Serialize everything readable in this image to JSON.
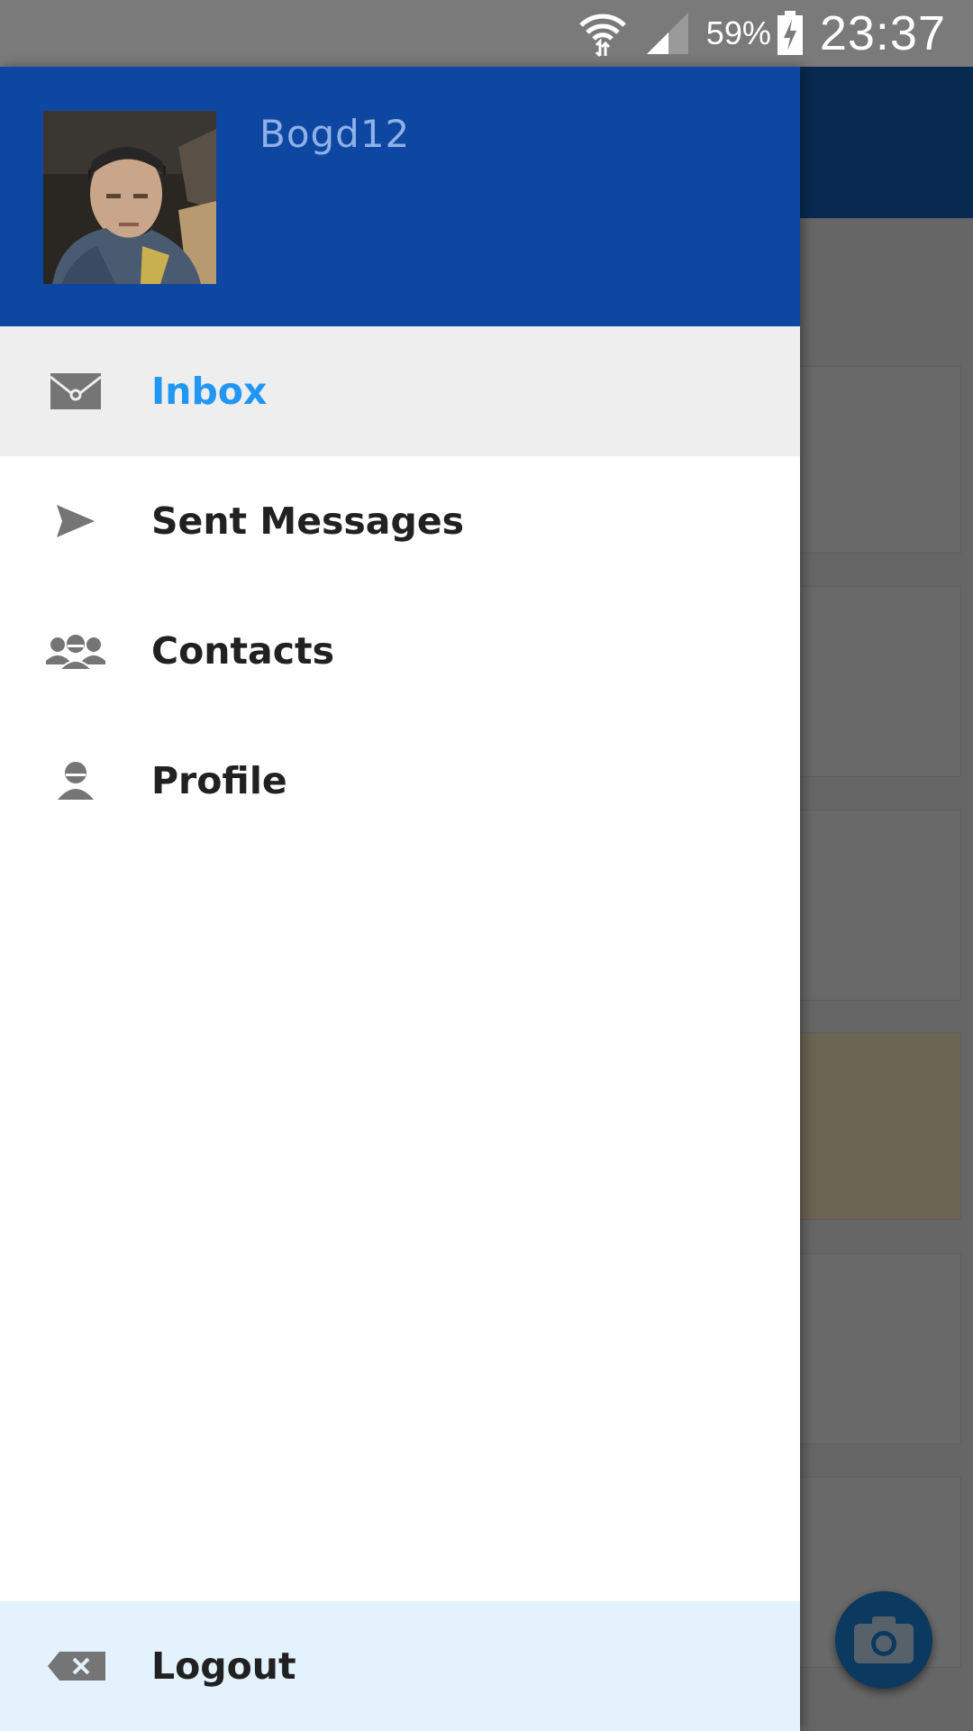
{
  "status_bar": {
    "battery_percent": "59%",
    "time": "23:37",
    "icons": [
      "wifi-icon",
      "signal-icon",
      "battery-charging-icon"
    ]
  },
  "drawer": {
    "username": "Bogd12",
    "items": [
      {
        "label": "Inbox",
        "icon": "envelope-icon",
        "active": true
      },
      {
        "label": "Sent Messages",
        "icon": "send-icon",
        "active": false
      },
      {
        "label": "Contacts",
        "icon": "group-icon",
        "active": false
      },
      {
        "label": "Profile",
        "icon": "person-icon",
        "active": false
      }
    ],
    "logout_label": "Logout"
  },
  "colors": {
    "header": "#0d47a1",
    "accent": "#2196f3",
    "active_item_bg": "#eeeeee",
    "logout_bg": "#e3f2fd"
  }
}
